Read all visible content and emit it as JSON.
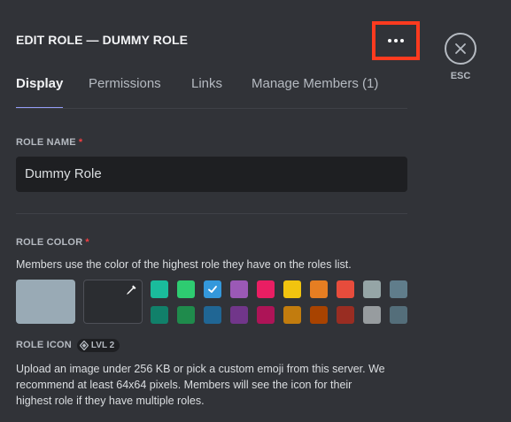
{
  "header": {
    "title": "EDIT ROLE — DUMMY ROLE",
    "more_icon": "more-horizontal-icon",
    "close_icon": "close-x-icon",
    "esc_label": "ESC"
  },
  "tabs": [
    {
      "label": "Display",
      "active": true
    },
    {
      "label": "Permissions",
      "active": false
    },
    {
      "label": "Links",
      "active": false
    },
    {
      "label": "Manage Members (1)",
      "active": false
    }
  ],
  "role_name": {
    "label": "ROLE NAME",
    "required_mark": "*",
    "value": "Dummy Role"
  },
  "role_color": {
    "label": "ROLE COLOR",
    "required_mark": "*",
    "description": "Members use the color of the highest role they have on the roles list.",
    "default_color": "#99aab5",
    "custom_icon": "eyedropper-icon",
    "selected_index": 2,
    "colors_top": [
      "#1abc9c",
      "#2ecc71",
      "#3498db",
      "#9b59b6",
      "#e91e63",
      "#f1c40f",
      "#e67e22",
      "#e74c3c",
      "#95a5a6",
      "#607d8b"
    ],
    "colors_bottom": [
      "#11806a",
      "#1f8b4c",
      "#206694",
      "#71368a",
      "#ad1457",
      "#c27c0e",
      "#a84300",
      "#992d22",
      "#979c9f",
      "#546e7a"
    ]
  },
  "role_icon": {
    "label": "ROLE ICON",
    "badge_icon": "boost-gem-icon",
    "badge": "LVL 2",
    "description_lines": [
      "Upload an image under 256 KB or pick a custom emoji from this server. We",
      "recommend at least 64x64 pixels. Members will see the icon for their",
      "highest role if they have multiple roles."
    ]
  },
  "highlight_color": "#ff3b1f",
  "accent_color": "#949cf7"
}
